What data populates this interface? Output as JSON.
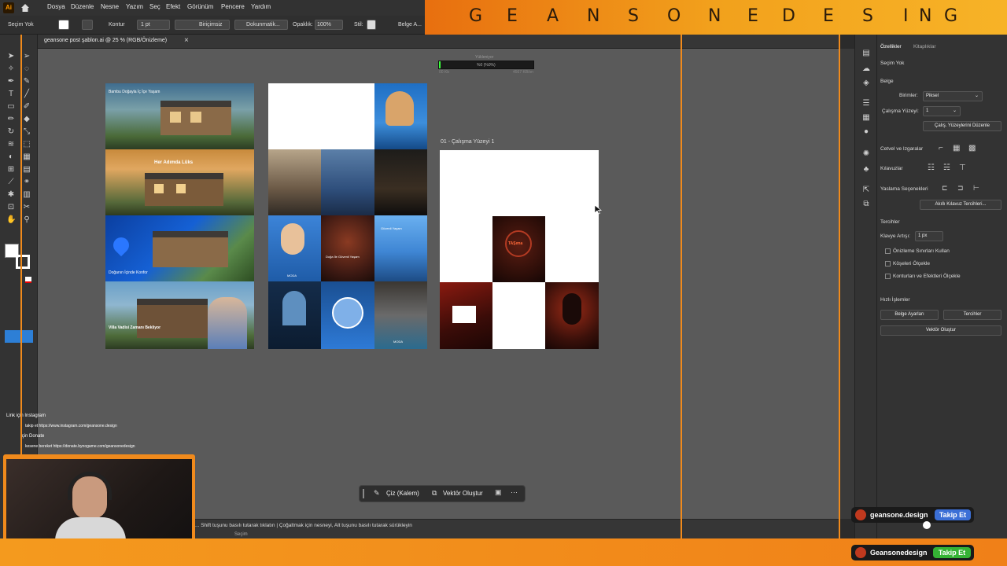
{
  "app": {
    "logo": "Ai",
    "home_icon": "home-icon"
  },
  "menu": [
    "Dosya",
    "Düzenle",
    "Nesne",
    "Yazım",
    "Seç",
    "Efekt",
    "Görünüm",
    "Pencere",
    "Yardım"
  ],
  "banner_letters": [
    "G",
    "E",
    "A",
    "N",
    "S",
    "O",
    "N",
    "E",
    "D",
    "E",
    "S",
    "I",
    "N",
    "G"
  ],
  "control": {
    "selection": "Seçim Yok",
    "stroke_label": "Kontur",
    "stroke_value": "1 pt",
    "line_label": "Biriçimsiz",
    "brush_label": "Dokunmatik...",
    "opacity_label": "Opaklık:",
    "opacity_value": "100%",
    "style_label": "Stil:",
    "doc_label": "Belge A..."
  },
  "tab": {
    "title": "geansone post şablon.ai @ 25 % (RGB/Önizleme)",
    "close": "×"
  },
  "canvas": {
    "artboard_label": "01 - Çalışma Yüzeyi 1",
    "progress_label": "Yükleniyor",
    "progress_value": "%0 (%0%)",
    "progress_left": "00 Kb",
    "progress_right": "4567 KB/sn"
  },
  "art1_captions": [
    "Bambu Doğayla İç İçe Yaşam",
    "Her Adımda Lüks",
    "Doğanın İçinde Konfor",
    "Villa Vadisi Zamanı Bekliyor"
  ],
  "art2_captions": [
    "MODA",
    "Doğa İle Güvenli Yaşam",
    "Güvenli Yaşam",
    "MODA"
  ],
  "tasim_label": "TAŞıma",
  "panel": {
    "tabs": [
      "Özellikler",
      "Kitaplıklar"
    ],
    "no_selection": "Seçim Yok",
    "doc_section": "Belge",
    "units_label": "Birimler:",
    "units_value": "Piksel",
    "artboard_label": "Çalışma Yüzeyi:",
    "artboard_value": "1",
    "edit_artboards": "Çalış. Yüzeylerini Düzenle",
    "rulers_grids": "Cetvel ve Izgaralar",
    "guides": "Kılavuzlar",
    "snap_options": "Yaslama Seçenekleri",
    "smart_guides_btn": "Akıllı Kılavuz Tercihleri...",
    "prefs": "Tercihler",
    "keyboard_increment_label": "Klavye Artışı:",
    "keyboard_increment_value": "1 px",
    "checkboxes": [
      "Önizleme Sınırları Kullan",
      "Köşeleri Ölçekle",
      "Konturları ve Efektleri Ölçekle"
    ],
    "quick_actions": "Hızlı İşlemler",
    "doc_setup": "Belge Ayarları",
    "preferences": "Tercihler",
    "create_vector": "Vektör Oluştur"
  },
  "overlay": {
    "lines": [
      "Link için Instagram",
      "takip et https://www.instagram.com/geansone.design",
      "İçin Donate",
      "kesene bereket https://donate.bynogame.com/geansonedesign"
    ]
  },
  "status": {
    "hint": "... Shift tuşunu basılı tutarak tıklatın  |  Çoğaltmak için nesneyi, Alt tuşunu basılı tutarak sürükleyin",
    "tool": "Seçim"
  },
  "contextbar": {
    "draw": "Çiz (Kalem)",
    "vector": "Vektör Oluştur"
  },
  "follow": [
    {
      "name": "geansone.design",
      "btn": "Takip Et",
      "btn_color": "#3b6fd6"
    },
    {
      "name": "Geansonedesign",
      "btn": "Takip Et",
      "btn_color": "#35b335"
    }
  ],
  "colors": {
    "accent": "#f08a1c",
    "canvas": "#5a5a5a",
    "panel": "#333333"
  }
}
